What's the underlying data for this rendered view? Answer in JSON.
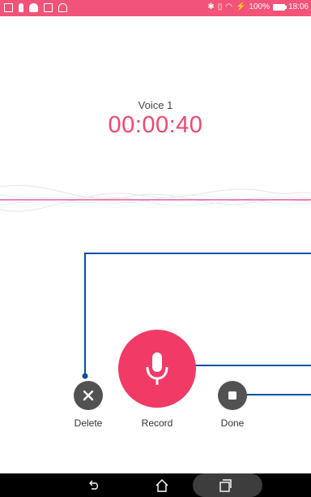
{
  "status_bar": {
    "right_text": "100%",
    "time": "18:06",
    "color": "#f25378"
  },
  "recording": {
    "title": "Voice 1",
    "elapsed": "00:00:40",
    "accent_color": "#f0486f"
  },
  "controls": {
    "delete_label": "Delete",
    "record_label": "Record",
    "done_label": "Done",
    "delete_icon": "close-icon",
    "record_icon": "microphone-icon",
    "done_icon": "stop-icon"
  },
  "nav": {
    "back_icon": "back-icon",
    "home_icon": "home-icon",
    "recents_icon": "recents-icon"
  }
}
